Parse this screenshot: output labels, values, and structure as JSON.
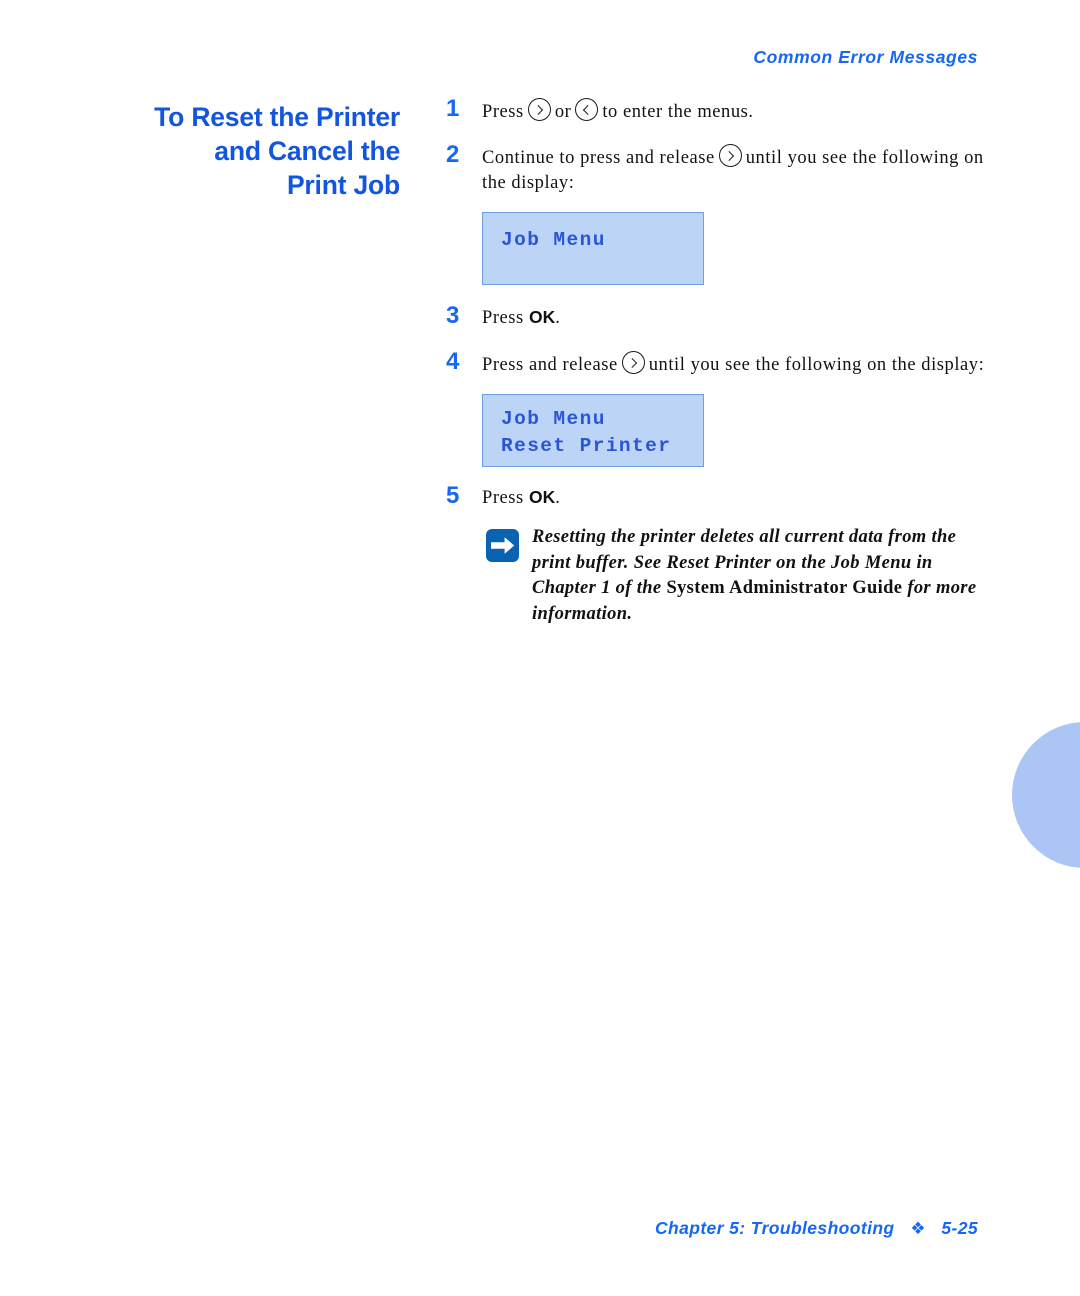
{
  "page": {
    "running_header": "Common Error Messages",
    "section_title_lines": [
      "To Reset the Printer",
      "and Cancel the",
      "Print Job"
    ],
    "accent_blue": "#1667f5",
    "title_blue": "#1256e0",
    "lcd_fill": "#bcd4f5",
    "lcd_border": "#6f9fe0",
    "lcd_text_color": "#2a56d6",
    "side_tab_color": "#abc6f5"
  },
  "steps": [
    {
      "number": "1",
      "text_before": "Press",
      "icon_1": "chevron-right-circle-icon",
      "text_middle": "or",
      "icon_2": "chevron-left-circle-icon",
      "text_after": "to enter the menus."
    },
    {
      "number": "2",
      "text_before": "Continue to press and release",
      "icon_1": "chevron-right-circle-icon",
      "text_after": "until you see the following on the display:"
    },
    {
      "number": "3",
      "text_before": "Press",
      "bold": "OK",
      "text_after": "."
    },
    {
      "number": "4",
      "text_before": "Press and release",
      "icon_1": "chevron-right-circle-icon",
      "text_after": "until you see the following on the display:"
    },
    {
      "number": "5",
      "text_before": "Press",
      "bold": "OK",
      "text_after": "."
    }
  ],
  "displays": {
    "first": {
      "line1": "Job Menu",
      "line2": ""
    },
    "second": {
      "line1": "Job Menu",
      "line2": "Reset Printer"
    }
  },
  "note": {
    "icon": "arrow-right-note-icon",
    "part_1": "Resetting the printer deletes all current data from the print buffer. See Reset Printer on the Job Menu in Chapter 1 of the ",
    "part_upright": "System Administrator Guide",
    "part_2": " for more information."
  },
  "footer": {
    "chapter": "Chapter 5: Troubleshooting",
    "separator": "❖",
    "page_number": "5-25"
  }
}
